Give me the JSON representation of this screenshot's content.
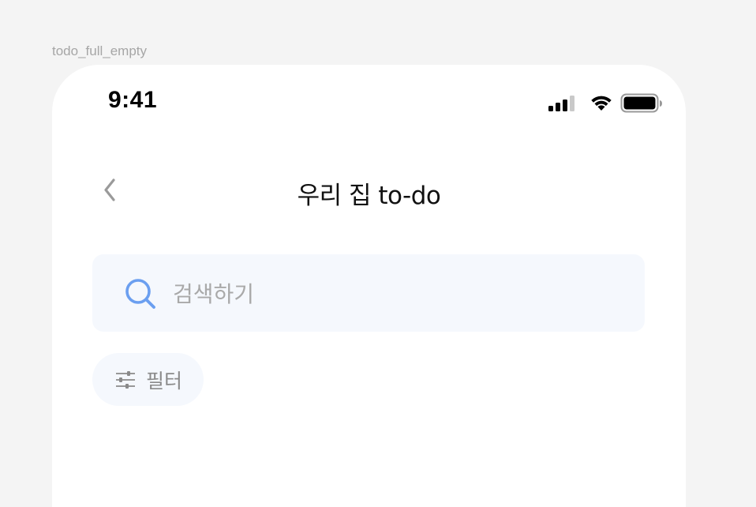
{
  "frame": {
    "label": "todo_full_empty"
  },
  "status_bar": {
    "time": "9:41",
    "icons": [
      "cellular-signal-icon",
      "wifi-icon",
      "battery-icon"
    ]
  },
  "nav": {
    "back_icon": "chevron-left-icon",
    "title": "우리 집 to-do"
  },
  "search": {
    "icon": "search-icon",
    "placeholder": "검색하기",
    "value": ""
  },
  "filter": {
    "icon": "sliders-icon",
    "label": "필터"
  },
  "colors": {
    "background": "#f4f4f4",
    "surface": "#ffffff",
    "field_bg": "#f5f8fd",
    "accent": "#6b9ff0",
    "muted_text": "#a9a9a9",
    "title_text": "#111111"
  }
}
